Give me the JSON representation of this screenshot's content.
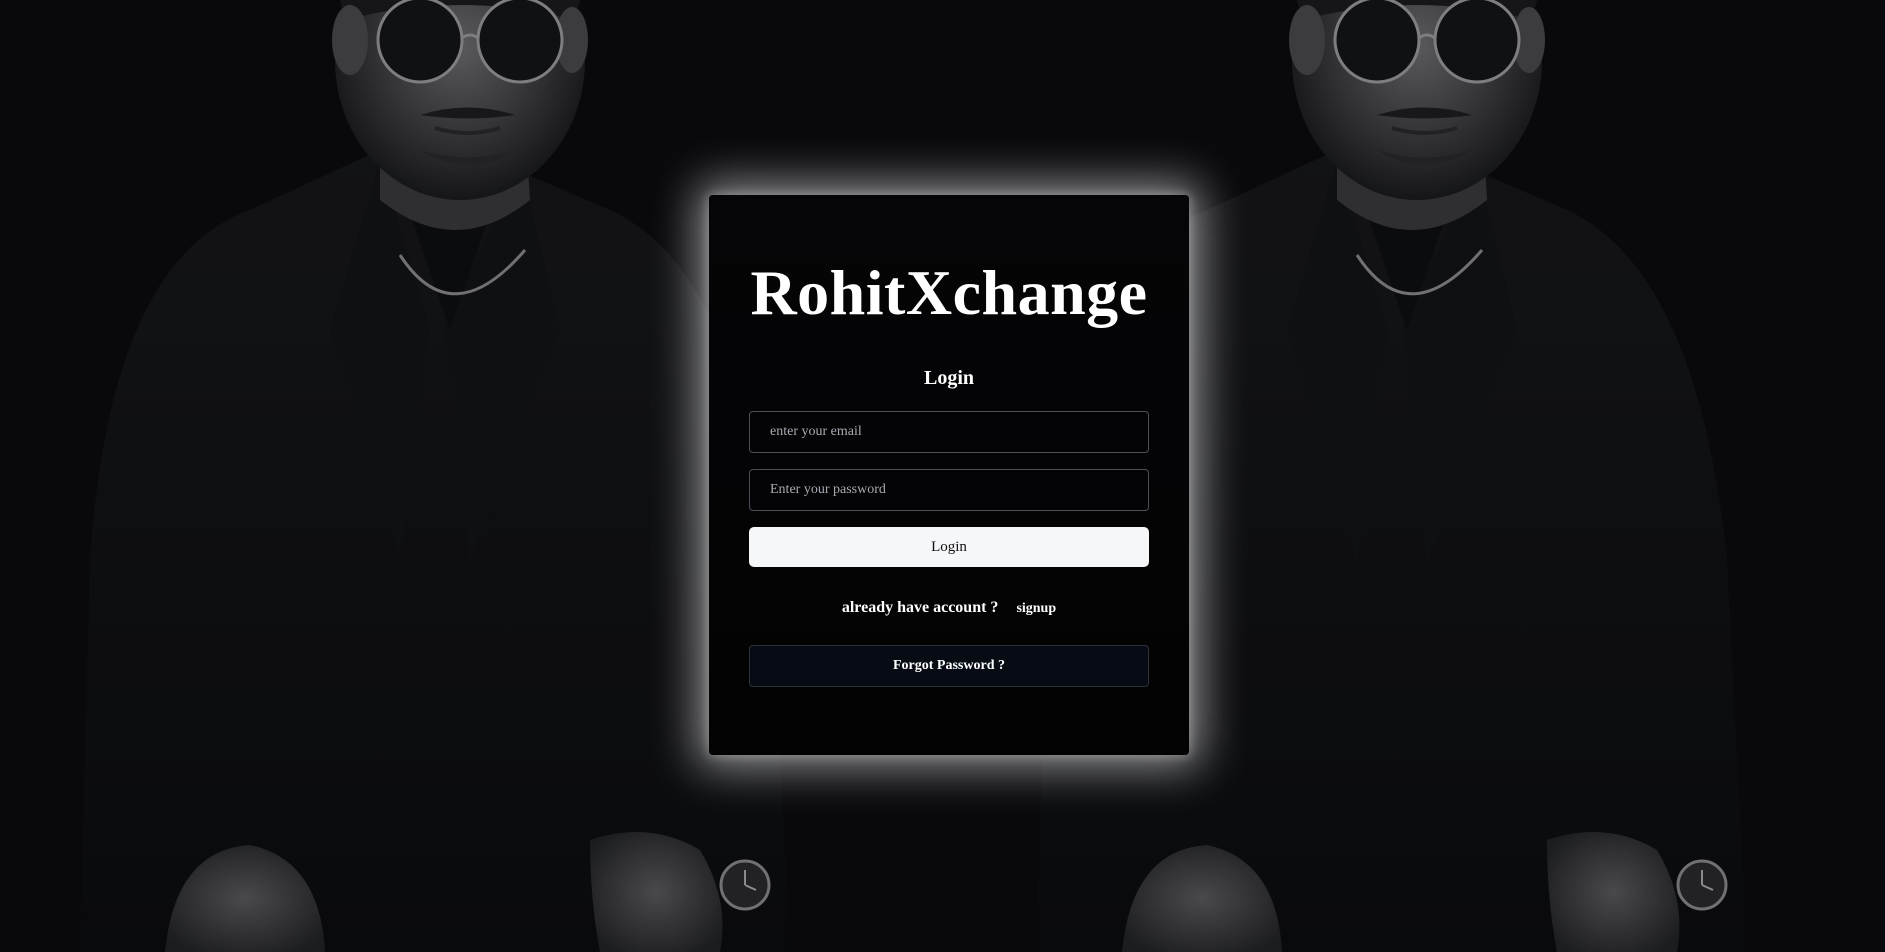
{
  "background": {
    "photo_name": "man-in-sunglasses-portrait",
    "tint": "#0b0c10"
  },
  "card": {
    "brand": "RohitXchange",
    "subtitle": "Login",
    "email_placeholder": "enter your email",
    "email_value": "",
    "password_placeholder": "Enter your password",
    "password_value": "",
    "login_label": "Login",
    "account_prompt": "already have account ?",
    "signup_label": "signup",
    "forgot_label": "Forgot Password ?",
    "glow_color": "#ffffff"
  }
}
